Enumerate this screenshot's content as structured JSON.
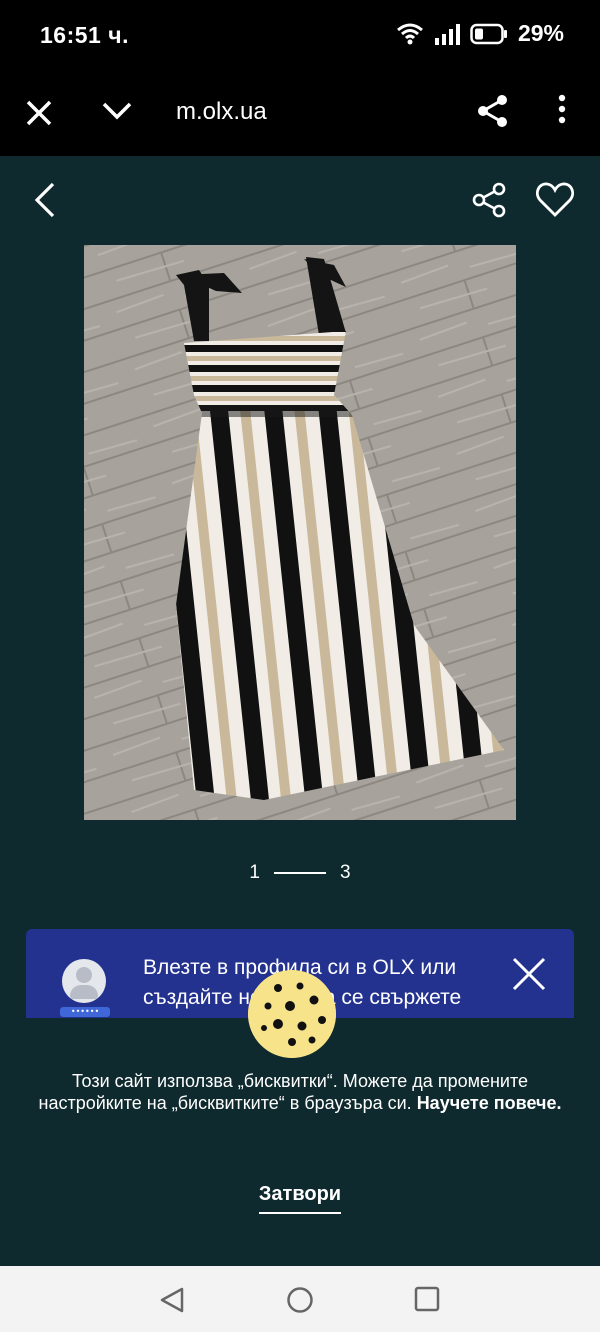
{
  "status_bar": {
    "time": "16:51 ч.",
    "battery": "29%"
  },
  "browser": {
    "url": "m.olx.ua"
  },
  "gallery": {
    "current": "1",
    "total": "3",
    "image_alt": "striped dress photo"
  },
  "login_banner": {
    "text": "Влезте в профила си в OLX или създайте нов, за да се свържете",
    "password_mask": "••••••"
  },
  "cookie": {
    "text": "Този сайт използва „бисквитки“. Можете да промените настройките на „бисквитките“ в браузъра си.",
    "link": "Научете повече.",
    "close": "Затвори"
  },
  "colors": {
    "content_bg": "#0f2a2e",
    "banner_bg": "#23318f",
    "cookie": "#f6e38a"
  }
}
